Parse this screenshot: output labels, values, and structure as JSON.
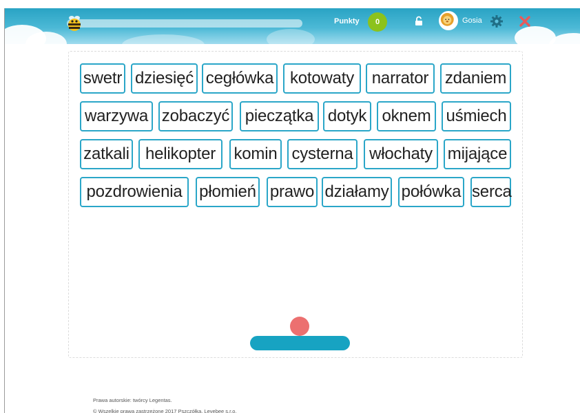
{
  "header": {
    "points_label": "Punkty",
    "points_value": "0",
    "user_name": "Gosia",
    "icons": [
      "bee-logo-icon",
      "unlock-icon",
      "lion-avatar-icon",
      "gear-icon",
      "close-icon"
    ],
    "colors": {
      "bar": "#29a3c4",
      "points_badge": "#8cc21c",
      "close": "#e85a5a"
    }
  },
  "bricks": [
    "swetr",
    "dziesięć",
    "cegłówka",
    "kotowaty",
    "narrator",
    "zdaniem",
    "warzywa",
    "zobaczyć",
    "pieczątka",
    "dotyk",
    "oknem",
    "uśmiech",
    "zatkali",
    "helikopter",
    "komin",
    "cysterna",
    "włochaty",
    "mijające",
    "pozdrowienia",
    "płomień",
    "prawo",
    "działamy",
    "połówka",
    "serca"
  ],
  "game": {
    "brick_border_color": "#2aa6c8",
    "ball_color": "#ec7070",
    "paddle_color": "#17a3c2"
  },
  "footer": {
    "copyright_line1": "Prawa autorskie: twórcy Legentas.",
    "copyright_line2": "© Wszelkie prawa zastrzeżone 2017 Pszczółka, Levebee s.r.o."
  }
}
